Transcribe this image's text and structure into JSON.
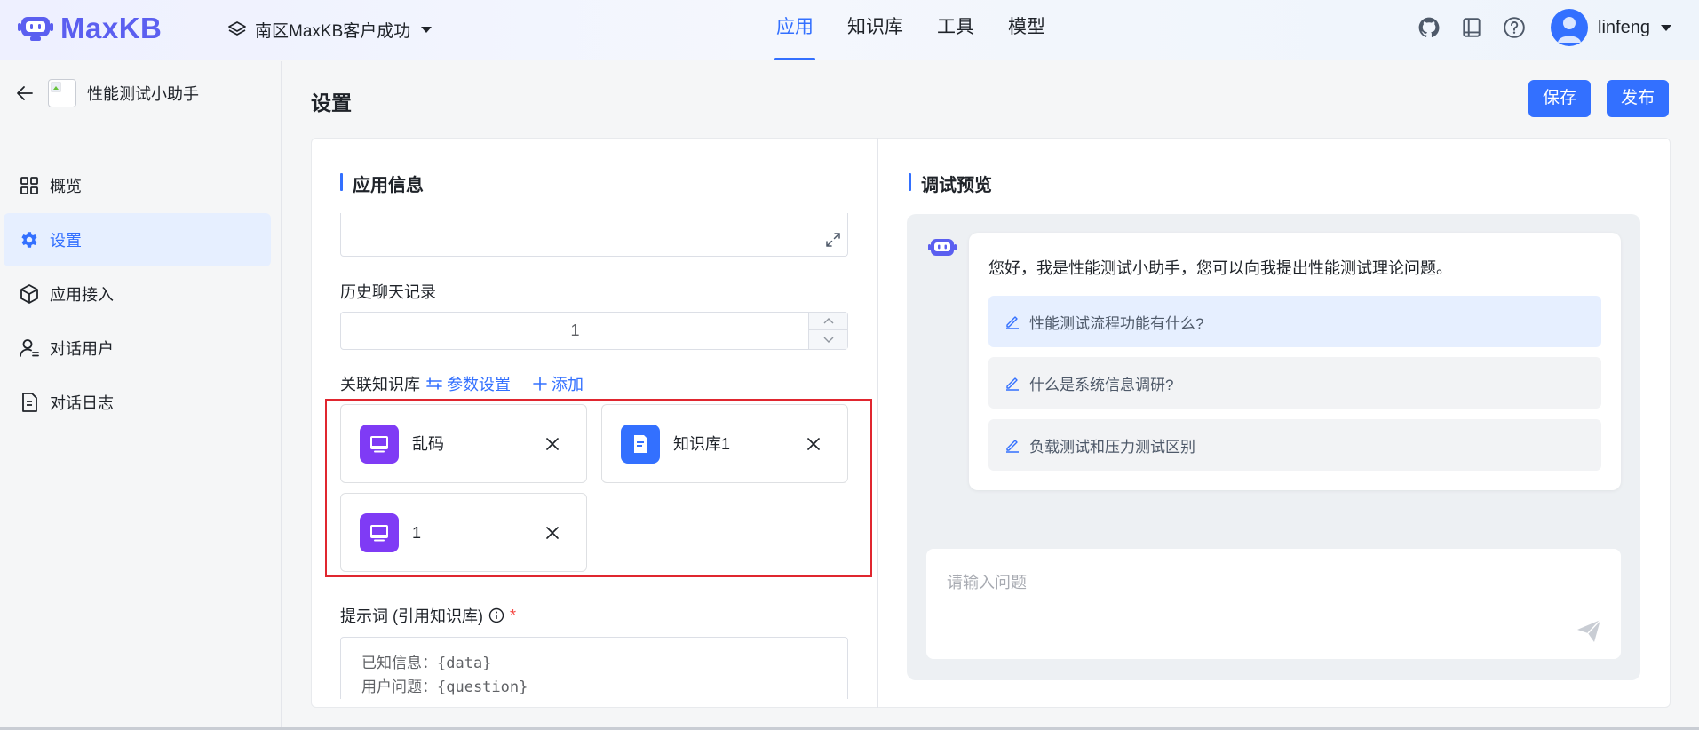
{
  "header": {
    "logo_text": "MaxKB",
    "workspace": "南区MaxKB客户成功",
    "nav": [
      "应用",
      "知识库",
      "工具",
      "模型"
    ],
    "active_nav": "应用",
    "icons": [
      "github-icon",
      "book-icon",
      "help-icon"
    ],
    "username": "linfeng"
  },
  "sidebar": {
    "app_name": "性能测试小助手",
    "items": [
      {
        "label": "概览",
        "icon": "grid-icon"
      },
      {
        "label": "设置",
        "icon": "gear-icon"
      },
      {
        "label": "应用接入",
        "icon": "cube-icon"
      },
      {
        "label": "对话用户",
        "icon": "user-icon"
      },
      {
        "label": "对话日志",
        "icon": "document-icon"
      }
    ],
    "active_item": "设置"
  },
  "page": {
    "title": "设置",
    "save_label": "保存",
    "publish_label": "发布"
  },
  "app_info": {
    "section_title": "应用信息",
    "history_label": "历史聊天记录",
    "history_value": "1",
    "kb_label": "关联知识库",
    "param_settings_label": "参数设置",
    "add_label": "添加",
    "knowledge_bases": [
      {
        "name": "乱码",
        "color": "#7f3bf5",
        "icon": "monitor-icon"
      },
      {
        "name": "知识库1",
        "color": "#3370ff",
        "icon": "document-icon"
      },
      {
        "name": "1",
        "color": "#7f3bf5",
        "icon": "monitor-icon"
      }
    ],
    "prompt_label": "提示词 (引用知识库)",
    "required_mark": "*",
    "prompt_lines": [
      "已知信息：{data}",
      "用户问题：{question}"
    ]
  },
  "preview": {
    "section_title": "调试预览",
    "greeting": "您好，我是性能测试小助手，您可以向我提出性能测试理论问题。",
    "suggestions": [
      "性能测试流程功能有什么?",
      "什么是系统信息调研?",
      "负载测试和压力测试区别"
    ],
    "input_placeholder": "请输入问题"
  },
  "colors": {
    "primary": "#3370ff",
    "purple": "#7f3bf5",
    "highlight_border": "#e0262f"
  }
}
